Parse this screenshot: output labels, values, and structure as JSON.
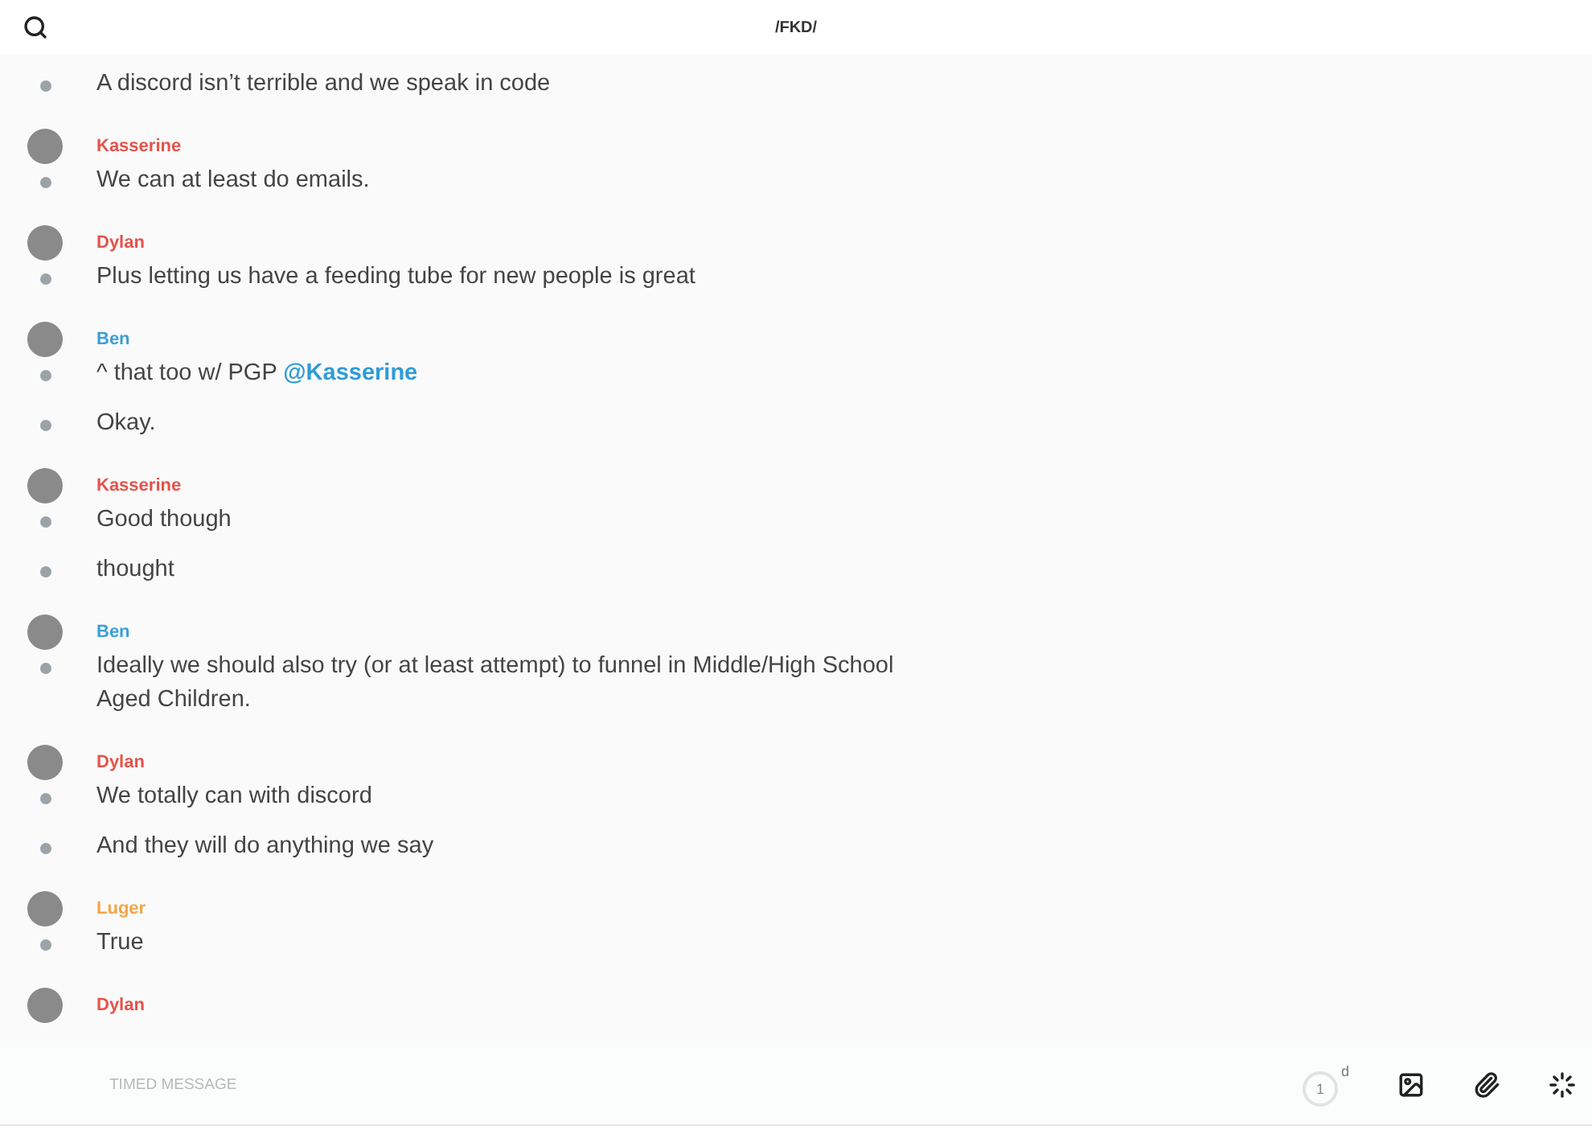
{
  "header": {
    "title": "/FKD/"
  },
  "groups": [
    {
      "messages": [
        {
          "text": "A discord isn’t terrible and we speak in code"
        }
      ]
    },
    {
      "author": "Kasserine",
      "color": "#e5534b",
      "messages": [
        {
          "text": "We can at least do emails."
        }
      ]
    },
    {
      "author": "Dylan",
      "color": "#e5534b",
      "messages": [
        {
          "text": "Plus letting us have a feeding tube for new people is great"
        }
      ]
    },
    {
      "author": "Ben",
      "color": "#3b9fd8",
      "messages": [
        {
          "text": "^ that too w/ PGP",
          "mention": "@Kasserine"
        },
        {
          "text": "Okay."
        }
      ]
    },
    {
      "author": "Kasserine",
      "color": "#e5534b",
      "messages": [
        {
          "text": "Good though"
        },
        {
          "text": "thought"
        }
      ]
    },
    {
      "author": "Ben",
      "color": "#3b9fd8",
      "messages": [
        {
          "text": "Ideally we should also try (or at least attempt) to funnel in Middle/High School Aged Children."
        }
      ]
    },
    {
      "author": "Dylan",
      "color": "#e5534b",
      "messages": [
        {
          "text": "We totally can with discord"
        },
        {
          "text": "And they will do anything we say"
        }
      ]
    },
    {
      "author": "Luger",
      "color": "#f5a544",
      "messages": [
        {
          "text": "True"
        }
      ]
    },
    {
      "author": "Dylan",
      "color": "#e5534b"
    }
  ],
  "composer": {
    "placeholder": "TIMED MESSAGE",
    "timer_value": "1",
    "timer_unit": "d"
  }
}
